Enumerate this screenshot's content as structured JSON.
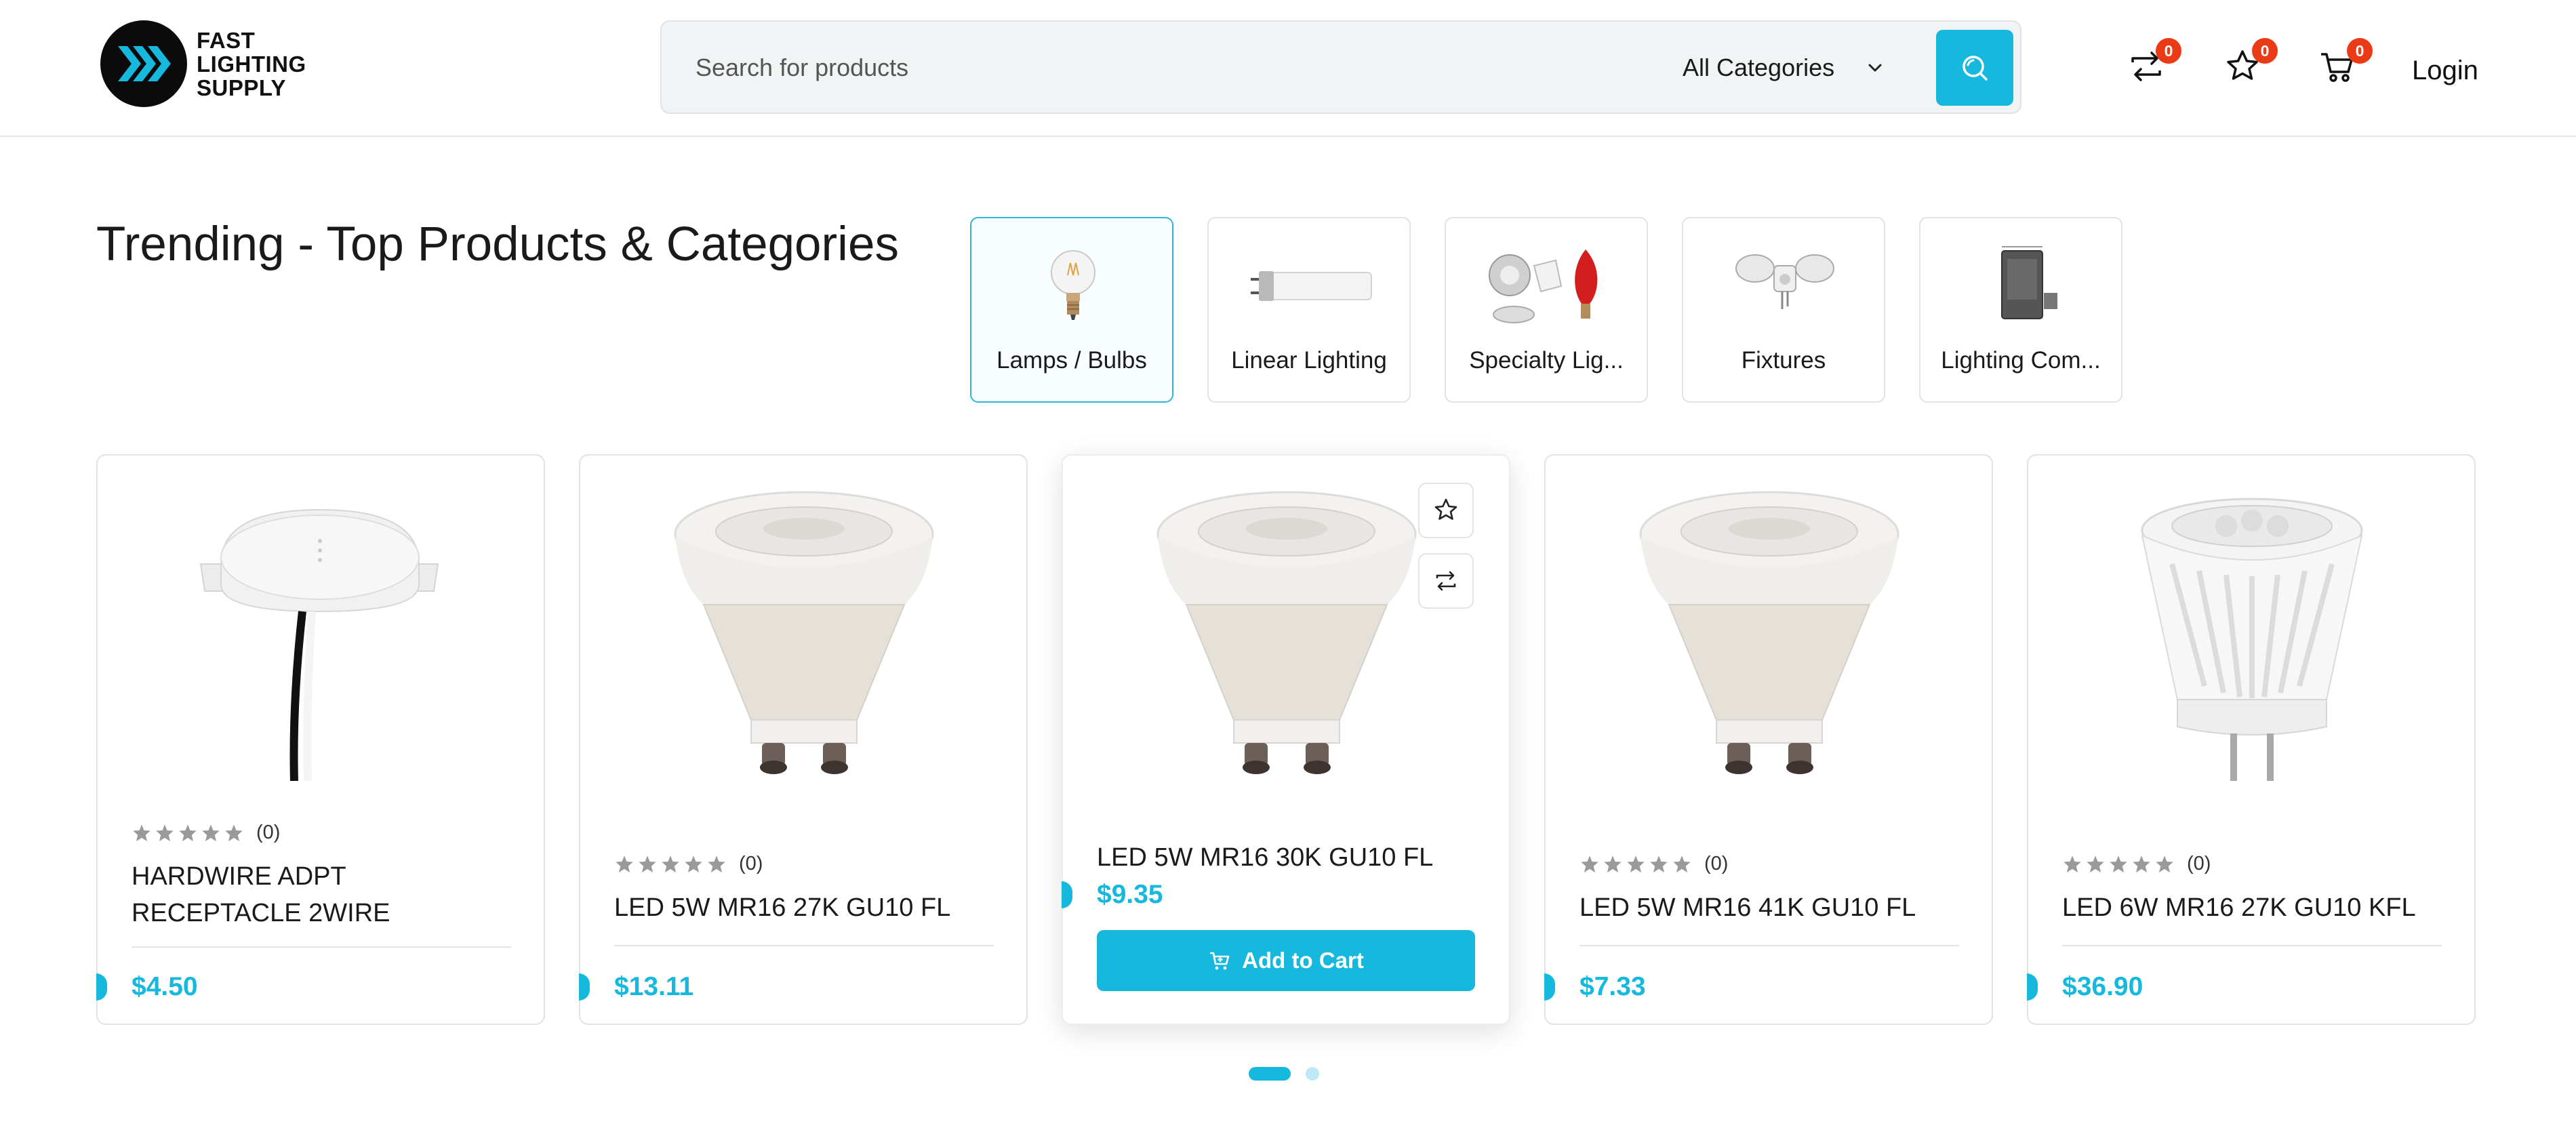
{
  "brand": {
    "line1": "FAST",
    "line2": "LIGHTING",
    "line3": "SUPPLY"
  },
  "search": {
    "placeholder": "Search for products",
    "category": "All Categories"
  },
  "header": {
    "compare_count": "0",
    "wishlist_count": "0",
    "cart_count": "0",
    "login_label": "Login"
  },
  "trending": {
    "title": "Trending - Top Products & Categories",
    "categories": [
      {
        "label": "Lamps / Bulbs",
        "icon": "filament-bulb",
        "active": true
      },
      {
        "label": "Linear Lighting",
        "icon": "tube-lamp"
      },
      {
        "label": "Specialty Lig...",
        "icon": "specialty-lamps"
      },
      {
        "label": "Fixtures",
        "icon": "security-fixture"
      },
      {
        "label": "Lighting Com...",
        "icon": "ballast-component"
      }
    ]
  },
  "products": [
    {
      "name": "HARDWIRE ADPT RECEPTACLE 2WIRE",
      "price": "$4.50",
      "rating_count": "(0)",
      "rating": 0,
      "image": "hardwire-adapter"
    },
    {
      "name": "LED 5W MR16 27K GU10 FL",
      "price": "$13.11",
      "rating_count": "(0)",
      "rating": 0,
      "image": "gu10-bulb"
    },
    {
      "name": "LED 5W MR16 30K GU10 FL",
      "price": "$9.35",
      "rating_count": "",
      "rating": 0,
      "image": "gu10-bulb",
      "hovered": true,
      "add_to_cart_label": "Add to Cart"
    },
    {
      "name": "LED 5W MR16 41K GU10 FL",
      "price": "$7.33",
      "rating_count": "(0)",
      "rating": 0,
      "image": "gu10-bulb"
    },
    {
      "name": "LED 6W MR16 27K GU10 KFL",
      "price": "$36.90",
      "rating_count": "(0)",
      "rating": 0,
      "image": "mr16-bulb"
    }
  ],
  "carousel": {
    "pages": 2,
    "active_page": 1
  },
  "colors": {
    "accent": "#16b8dd",
    "badge": "#ea3b16",
    "text": "#1a1a1a",
    "border": "#e2e2e2"
  }
}
